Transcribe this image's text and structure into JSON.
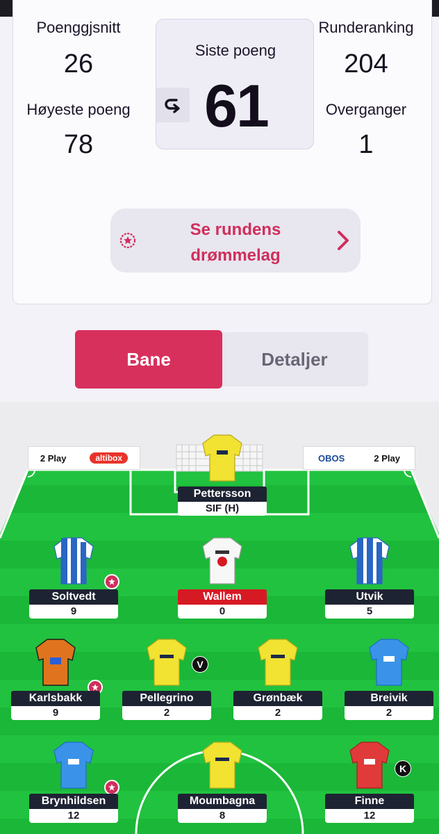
{
  "stats": {
    "avg_label": "Poenggjsnitt",
    "avg_value": "26",
    "rank_label": "Runderanking",
    "rank_value": "204",
    "high_label": "Høyeste poeng",
    "high_value": "78",
    "transfers_label": "Overganger",
    "transfers_value": "1",
    "last_label": "Siste poeng",
    "last_value": "61"
  },
  "dream_team": {
    "label_line1": "Se rundens",
    "label_line2": "drømmelag"
  },
  "tabs": {
    "pitch": "Bane",
    "details": "Detaljer"
  },
  "ads": {
    "left_1": "2 Play",
    "left_2": "altibox",
    "right_1": "OBOS",
    "right_2": "2 Play"
  },
  "goalkeeper": {
    "name": "Pettersson",
    "fixture": "SIF (H)"
  },
  "defenders": [
    {
      "name": "Soltvedt",
      "points": "9"
    },
    {
      "name": "Wallem",
      "points": "0"
    },
    {
      "name": "Utvik",
      "points": "5"
    }
  ],
  "midfielders": [
    {
      "name": "Karlsbakk",
      "points": "9"
    },
    {
      "name": "Pellegrino",
      "points": "2"
    },
    {
      "name": "Grønbæk",
      "points": "2"
    },
    {
      "name": "Breivik",
      "points": "2"
    }
  ],
  "forwards": [
    {
      "name": "Brynhildsen",
      "points": "12"
    },
    {
      "name": "Moumbagna",
      "points": "8"
    },
    {
      "name": "Finne",
      "points": "12"
    }
  ],
  "badges": {
    "vice_captain": "V",
    "captain": "K"
  },
  "colors": {
    "accent": "#d8305c",
    "pitch_green": "#1fbf3c",
    "pitch_green_dark": "#17ad33"
  }
}
